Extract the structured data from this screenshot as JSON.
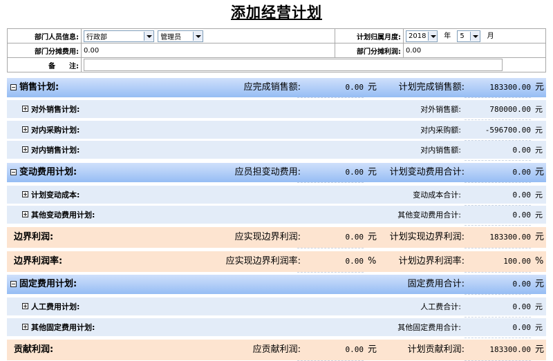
{
  "page_title": "添加经营计划",
  "info": {
    "dept_staff_label": "部门人员信息:",
    "dept_value": "行政部",
    "staff_value": "管理员",
    "month_label": "计划归属月度:",
    "year_value": "2018",
    "year_unit": "年",
    "month_value": "5",
    "month_unit": "月",
    "dept_cost_label": "部门分摊费用:",
    "dept_cost_value": "0.00",
    "dept_profit_label": "部门分摊利润:",
    "dept_profit_value": "0.00",
    "remark_label": "备　　注:",
    "remark_value": ""
  },
  "sections": {
    "sales": {
      "label": "销售计划:",
      "cap1": "应完成销售额:",
      "val1": "0.00",
      "unit1": "元",
      "cap2": "计划完成销售额:",
      "val2": "183300.00",
      "unit2": "元"
    },
    "sales_ext": {
      "label": "对外销售计划:",
      "cap": "对外销售额:",
      "val": "780000.00",
      "unit": "元"
    },
    "purchase_int": {
      "label": "对内采购计划:",
      "cap": "对内采购额:",
      "val": "-596700.00",
      "unit": "元"
    },
    "sales_int": {
      "label": "对内销售计划:",
      "cap": "对内销售额:",
      "val": "0.00",
      "unit": "元"
    },
    "var_cost": {
      "label": "变动费用计划:",
      "cap1": "应员担变动费用:",
      "val1": "0.00",
      "unit1": "元",
      "cap2": "计划变动费用合计:",
      "val2": "0.00",
      "unit2": "元"
    },
    "plan_var_cost": {
      "label": "计划变动成本:",
      "cap": "变动成本合计:",
      "val": "0.00",
      "unit": "元"
    },
    "other_var_cost": {
      "label": "其他变动费用计划:",
      "cap": "其他变动费用合计:",
      "val": "0.00",
      "unit": "元"
    },
    "margin": {
      "label": "边界利润:",
      "cap1": "应实现边界利润:",
      "val1": "0.00",
      "unit1": "元",
      "cap2": "计划实现边界利润:",
      "val2": "183300.00",
      "unit2": "元"
    },
    "margin_rate": {
      "label": "边界利润率:",
      "cap1": "应实现边界利润率:",
      "val1": "0.00",
      "unit1": "%",
      "cap2": "计划边界利润率:",
      "val2": "100.00",
      "unit2": "%"
    },
    "fixed_cost": {
      "label": "固定费用计划:",
      "cap": "固定费用合计:",
      "val": "0.00",
      "unit": "元"
    },
    "labor_cost": {
      "label": "人工费用计划:",
      "cap": "人工费合计:",
      "val": "0.00",
      "unit": "元"
    },
    "other_fixed": {
      "label": "其他固定费用计划:",
      "cap": "其他固定费用合计:",
      "val": "0.00",
      "unit": "元"
    },
    "contribution": {
      "label": "贡献利润:",
      "cap1": "应贡献利润:",
      "val1": "0.00",
      "unit1": "元",
      "cap2": "计划贡献利润:",
      "val2": "183300.00",
      "unit2": "元"
    }
  }
}
